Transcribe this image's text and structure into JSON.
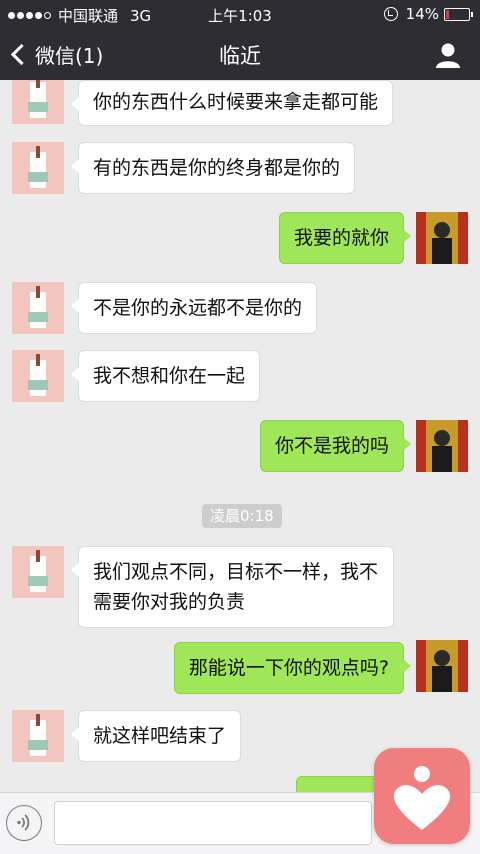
{
  "status_bar": {
    "carrier": "中国联通",
    "network": "3G",
    "time": "上午1:03",
    "battery": "14%",
    "battery_level": 0.14
  },
  "header": {
    "back_label": "微信(1)",
    "title": "临近"
  },
  "messages": [
    {
      "from": "them",
      "text": "你的东西什么时候要来拿走都可能"
    },
    {
      "from": "them",
      "text": "有的东西是你的终身都是你的"
    },
    {
      "from": "me",
      "text": "我要的就你"
    },
    {
      "from": "them",
      "text": "不是你的永远都不是你的"
    },
    {
      "from": "them",
      "text": "我不想和你在一起"
    },
    {
      "from": "me",
      "text": "你不是我的吗"
    },
    {
      "from": "them",
      "text": "我们观点不同，目标不一样，我不需要你对我的负责"
    },
    {
      "from": "me",
      "text": "那能说一下你的观点吗?"
    },
    {
      "from": "them",
      "text": "就这样吧结束了"
    }
  ],
  "timestamp": "凌晨0:18",
  "colors": {
    "header_bg": "#2e2d33",
    "chat_bg": "#ebebeb",
    "bubble_in": "#ffffff",
    "bubble_out": "#9fe658",
    "overlay_icon": "#f07e7e"
  }
}
